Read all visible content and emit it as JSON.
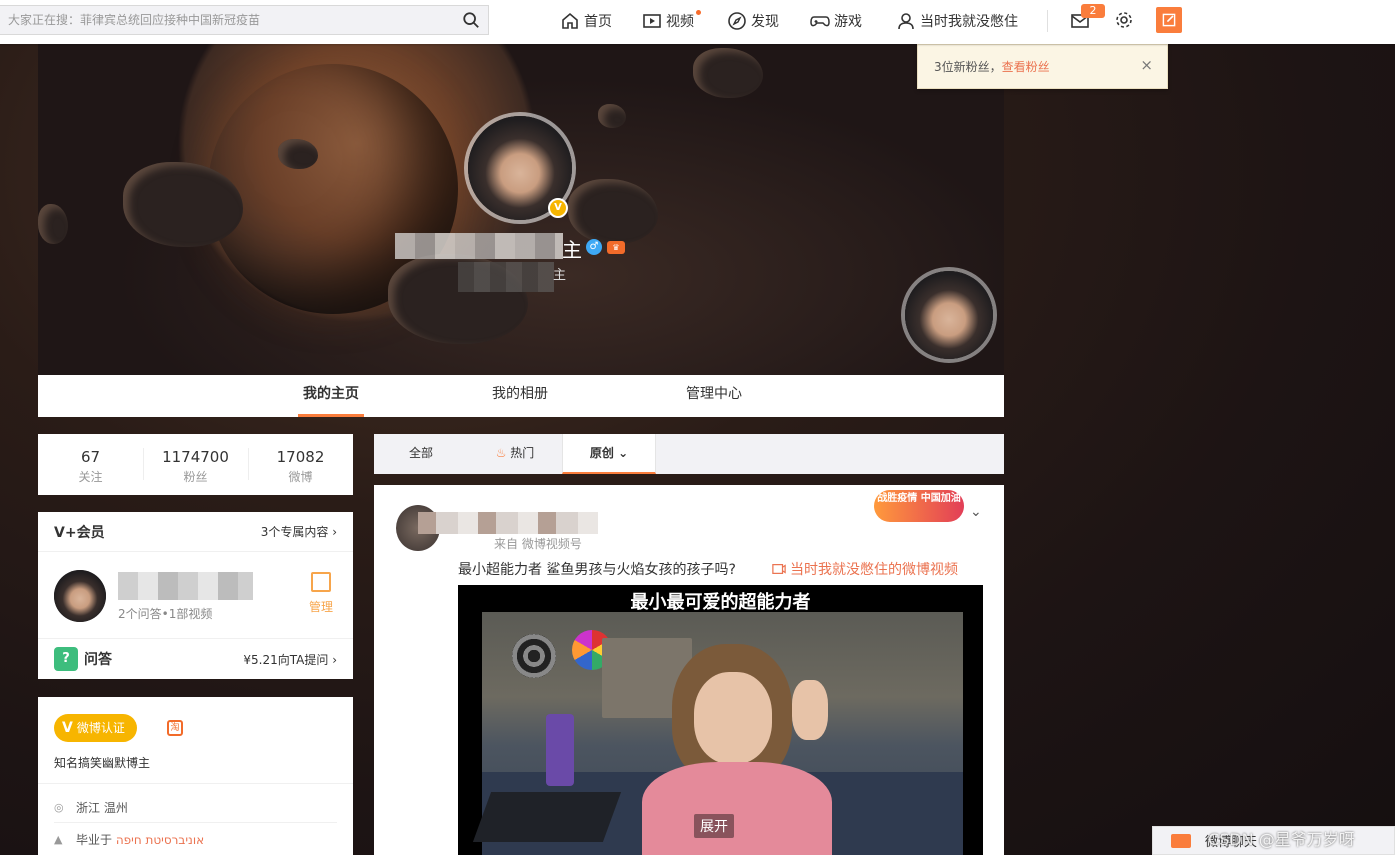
{
  "search": {
    "placeholder": "大家正在搜：菲律宾总统回应接种中国新冠疫苗"
  },
  "nav": {
    "home": "首页",
    "video": "视频",
    "discover": "发现",
    "game": "游戏",
    "user": "当时我就没憋住",
    "message_count": "2"
  },
  "notification": {
    "text": "3位新粉丝，",
    "link": "查看粉丝",
    "close": "×"
  },
  "profile": {
    "name_tail": "主",
    "intro_tail": "主",
    "gender_icon": "male-icon",
    "badge_icon": "verified-v-icon"
  },
  "profile_tabs": [
    "我的主页",
    "我的相册",
    "管理中心"
  ],
  "stats": [
    {
      "value": "67",
      "label": "关注"
    },
    {
      "value": "1174700",
      "label": "粉丝"
    },
    {
      "value": "17082",
      "label": "微博"
    }
  ],
  "vplus": {
    "title": "V+会员",
    "more": "3个专属内容",
    "subtitle": "2个问答•1部视频",
    "manage": "管理",
    "qa_title": "问答",
    "qa_price": "¥5.21向TA提问"
  },
  "info": {
    "verify_label": "微博认证",
    "verify_desc": "知名搞笑幽默博主",
    "location": "浙江 温州",
    "school_prefix": "毕业于",
    "school": "אוניברסיטת חיפה"
  },
  "feed_filters": [
    "全部",
    "热门",
    "原创"
  ],
  "post": {
    "meta": "来自 微博视频号",
    "tag": "战胜疫情 中国加油",
    "text": "最小超能力者 鲨鱼男孩与火焰女孩的孩子吗?",
    "source": "当时我就没憋住的微博视频",
    "video_title": "最小最可爱的超能力者",
    "expand": "展开"
  },
  "chat": {
    "label": "微博聊天"
  },
  "watermark": "CSDN @星爷万岁呀",
  "colors": {
    "accent": "#fa7d3c",
    "link": "#eb7350",
    "verify": "#f7b500",
    "qa": "#3dbd7d"
  }
}
